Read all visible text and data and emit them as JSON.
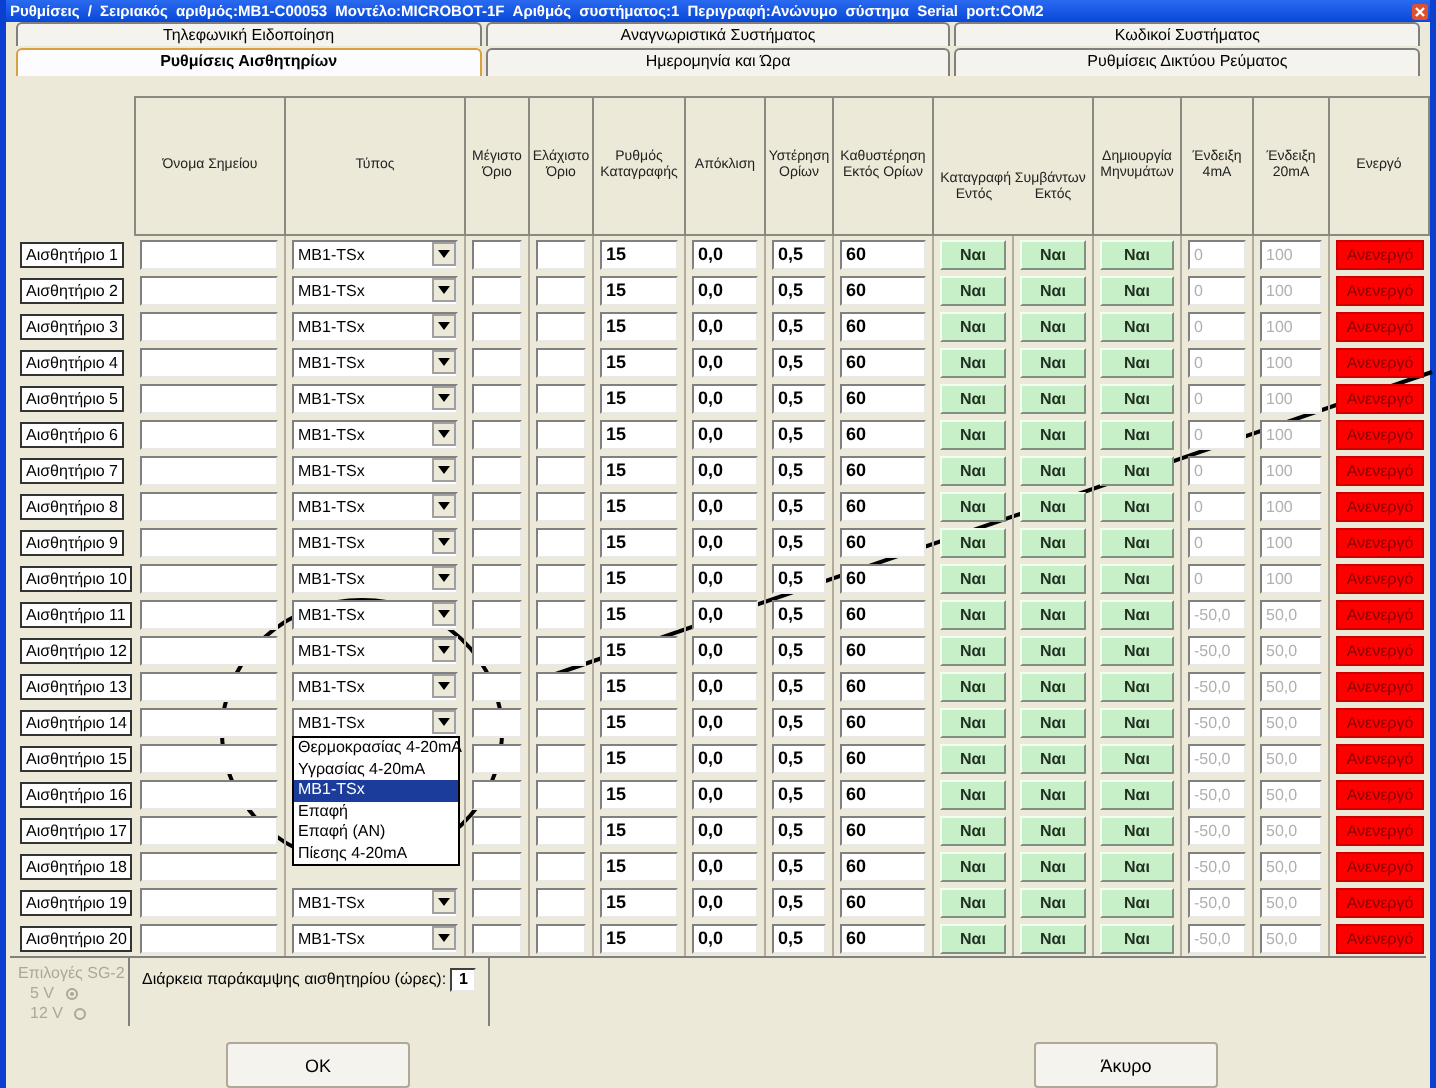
{
  "window": {
    "title": "Ρυθμίσεις / Σειριακός αριθμός:MB1-C00053 Μοντέλο:MICROBOT-1F Αριθμός συστήματος:1 Περιγραφή:Ανώνυμο σύστημα Serial port:COM2"
  },
  "tab_rows": [
    {
      "tabs": [
        {
          "label": "Τηλεφωνική Ειδοποίηση",
          "selected": false
        },
        {
          "label": "Αναγνωριστικά Συστήματος",
          "selected": false
        },
        {
          "label": "Κωδικοί Συστήματος",
          "selected": false
        }
      ]
    },
    {
      "tabs": [
        {
          "label": "Ρυθμίσεις Αισθητηρίων",
          "selected": true
        },
        {
          "label": "Ημερομηνία και Ώρα",
          "selected": false
        },
        {
          "label": "Ρυθμίσεις Δικτύου Ρεύματος",
          "selected": false
        }
      ]
    }
  ],
  "table": {
    "columns": [
      {
        "label": "Όνομα Σημείου",
        "kind": "text"
      },
      {
        "label": "Τύπος",
        "kind": "select"
      },
      {
        "label": "Μέγιστο Όριο",
        "kind": "text"
      },
      {
        "label": "Ελάχιστο Όριο",
        "kind": "text"
      },
      {
        "label": "Ρυθμός Καταγραφής",
        "kind": "number"
      },
      {
        "label": "Απόκλιση",
        "kind": "number"
      },
      {
        "label": "Υστέρηση Ορίων",
        "kind": "number"
      },
      {
        "label": "Καθυστέρηση Εκτός Ορίων",
        "kind": "number"
      },
      {
        "label": "Καταγραφή Συμβάντων",
        "children": [
          {
            "label": "Εντός",
            "kind": "toggle"
          },
          {
            "label": "Εκτός",
            "kind": "toggle"
          }
        ]
      },
      {
        "label": "Δημιουργία Μηνυμάτων",
        "kind": "toggle"
      },
      {
        "label": "Ένδειξη 4mA",
        "kind": "dimmed"
      },
      {
        "label": "Ένδειξη 20mA",
        "kind": "dimmed"
      },
      {
        "label": "Ενεργό",
        "kind": "status"
      }
    ],
    "rows": [
      {
        "sensor": "Αισθητήριο 1",
        "type": "MB1-TSx",
        "rate": "15",
        "deviation": "0,0",
        "hysteresis": "0,5",
        "delay": "60",
        "event_in": "Ναι",
        "event_out": "Ναι",
        "messages": "Ναι",
        "reading_4ma": "0",
        "reading_20ma": "100",
        "active": "Ανενεργό"
      },
      {
        "sensor": "Αισθητήριο 2",
        "type": "MB1-TSx",
        "rate": "15",
        "deviation": "0,0",
        "hysteresis": "0,5",
        "delay": "60",
        "event_in": "Ναι",
        "event_out": "Ναι",
        "messages": "Ναι",
        "reading_4ma": "0",
        "reading_20ma": "100",
        "active": "Ανενεργό"
      },
      {
        "sensor": "Αισθητήριο 3",
        "type": "MB1-TSx",
        "rate": "15",
        "deviation": "0,0",
        "hysteresis": "0,5",
        "delay": "60",
        "event_in": "Ναι",
        "event_out": "Ναι",
        "messages": "Ναι",
        "reading_4ma": "0",
        "reading_20ma": "100",
        "active": "Ανενεργό"
      },
      {
        "sensor": "Αισθητήριο 4",
        "type": "MB1-TSx",
        "rate": "15",
        "deviation": "0,0",
        "hysteresis": "0,5",
        "delay": "60",
        "event_in": "Ναι",
        "event_out": "Ναι",
        "messages": "Ναι",
        "reading_4ma": "0",
        "reading_20ma": "100",
        "active": "Ανενεργό"
      },
      {
        "sensor": "Αισθητήριο 5",
        "type": "MB1-TSx",
        "rate": "15",
        "deviation": "0,0",
        "hysteresis": "0,5",
        "delay": "60",
        "event_in": "Ναι",
        "event_out": "Ναι",
        "messages": "Ναι",
        "reading_4ma": "0",
        "reading_20ma": "100",
        "active": "Ανενεργό"
      },
      {
        "sensor": "Αισθητήριο 6",
        "type": "MB1-TSx",
        "rate": "15",
        "deviation": "0,0",
        "hysteresis": "0,5",
        "delay": "60",
        "event_in": "Ναι",
        "event_out": "Ναι",
        "messages": "Ναι",
        "reading_4ma": "0",
        "reading_20ma": "100",
        "active": "Ανενεργό"
      },
      {
        "sensor": "Αισθητήριο 7",
        "type": "MB1-TSx",
        "rate": "15",
        "deviation": "0,0",
        "hysteresis": "0,5",
        "delay": "60",
        "event_in": "Ναι",
        "event_out": "Ναι",
        "messages": "Ναι",
        "reading_4ma": "0",
        "reading_20ma": "100",
        "active": "Ανενεργό"
      },
      {
        "sensor": "Αισθητήριο 8",
        "type": "MB1-TSx",
        "rate": "15",
        "deviation": "0,0",
        "hysteresis": "0,5",
        "delay": "60",
        "event_in": "Ναι",
        "event_out": "Ναι",
        "messages": "Ναι",
        "reading_4ma": "0",
        "reading_20ma": "100",
        "active": "Ανενεργό"
      },
      {
        "sensor": "Αισθητήριο 9",
        "type": "MB1-TSx",
        "rate": "15",
        "deviation": "0,0",
        "hysteresis": "0,5",
        "delay": "60",
        "event_in": "Ναι",
        "event_out": "Ναι",
        "messages": "Ναι",
        "reading_4ma": "0",
        "reading_20ma": "100",
        "active": "Ανενεργό"
      },
      {
        "sensor": "Αισθητήριο 10",
        "type": "MB1-TSx",
        "rate": "15",
        "deviation": "0,0",
        "hysteresis": "0,5",
        "delay": "60",
        "event_in": "Ναι",
        "event_out": "Ναι",
        "messages": "Ναι",
        "reading_4ma": "0",
        "reading_20ma": "100",
        "active": "Ανενεργό"
      },
      {
        "sensor": "Αισθητήριο 11",
        "type": "MB1-TSx",
        "rate": "15",
        "deviation": "0,0",
        "hysteresis": "0,5",
        "delay": "60",
        "event_in": "Ναι",
        "event_out": "Ναι",
        "messages": "Ναι",
        "reading_4ma": "-50,0",
        "reading_20ma": "50,0",
        "active": "Ανενεργό"
      },
      {
        "sensor": "Αισθητήριο 12",
        "type": "MB1-TSx",
        "rate": "15",
        "deviation": "0,0",
        "hysteresis": "0,5",
        "delay": "60",
        "event_in": "Ναι",
        "event_out": "Ναι",
        "messages": "Ναι",
        "reading_4ma": "-50,0",
        "reading_20ma": "50,0",
        "active": "Ανενεργό"
      },
      {
        "sensor": "Αισθητήριο 13",
        "type": "MB1-TSx",
        "rate": "15",
        "deviation": "0,0",
        "hysteresis": "0,5",
        "delay": "60",
        "event_in": "Ναι",
        "event_out": "Ναι",
        "messages": "Ναι",
        "reading_4ma": "-50,0",
        "reading_20ma": "50,0",
        "active": "Ανενεργό"
      },
      {
        "sensor": "Αισθητήριο 14",
        "type": "MB1-TSx",
        "open": true,
        "options": [
          {
            "label": "Θερμοκρασίας 4-20mA",
            "selected": false
          },
          {
            "label": "Υγρασίας 4-20mA",
            "selected": false
          },
          {
            "label": "MB1-TSx",
            "selected": true
          },
          {
            "label": "Επαφή",
            "selected": false
          },
          {
            "label": "Επαφή (AN)",
            "selected": false
          },
          {
            "label": "Πίεσης 4-20mA",
            "selected": false
          }
        ],
        "rate": "15",
        "deviation": "0,0",
        "hysteresis": "0,5",
        "delay": "60",
        "event_in": "Ναι",
        "event_out": "Ναι",
        "messages": "Ναι",
        "reading_4ma": "-50,0",
        "reading_20ma": "50,0",
        "active": "Ανενεργό"
      },
      {
        "sensor": "Αισθητήριο 15",
        "rate": "15",
        "deviation": "0,0",
        "hysteresis": "0,5",
        "delay": "60",
        "event_in": "Ναι",
        "event_out": "Ναι",
        "messages": "Ναι",
        "reading_4ma": "-50,0",
        "reading_20ma": "50,0",
        "active": "Ανενεργό"
      },
      {
        "sensor": "Αισθητήριο 16",
        "rate": "15",
        "deviation": "0,0",
        "hysteresis": "0,5",
        "delay": "60",
        "event_in": "Ναι",
        "event_out": "Ναι",
        "messages": "Ναι",
        "reading_4ma": "-50,0",
        "reading_20ma": "50,0",
        "active": "Ανενεργό"
      },
      {
        "sensor": "Αισθητήριο 17",
        "rate": "15",
        "deviation": "0,0",
        "hysteresis": "0,5",
        "delay": "60",
        "event_in": "Ναι",
        "event_out": "Ναι",
        "messages": "Ναι",
        "reading_4ma": "-50,0",
        "reading_20ma": "50,0",
        "active": "Ανενεργό"
      },
      {
        "sensor": "Αισθητήριο 18",
        "rate": "15",
        "deviation": "0,0",
        "hysteresis": "0,5",
        "delay": "60",
        "event_in": "Ναι",
        "event_out": "Ναι",
        "messages": "Ναι",
        "reading_4ma": "-50,0",
        "reading_20ma": "50,0",
        "active": "Ανενεργό"
      },
      {
        "sensor": "Αισθητήριο 19",
        "type": "MB1-TSx",
        "rate": "15",
        "deviation": "0,0",
        "hysteresis": "0,5",
        "delay": "60",
        "event_in": "Ναι",
        "event_out": "Ναι",
        "messages": "Ναι",
        "reading_4ma": "-50,0",
        "reading_20ma": "50,0",
        "active": "Ανενεργό"
      },
      {
        "sensor": "Αισθητήριο 20",
        "type": "MB1-TSx",
        "rate": "15",
        "deviation": "0,0",
        "hysteresis": "0,5",
        "delay": "60",
        "event_in": "Ναι",
        "event_out": "Ναι",
        "messages": "Ναι",
        "reading_4ma": "-50,0",
        "reading_20ma": "50,0",
        "active": "Ανενεργό"
      }
    ]
  },
  "sg2": {
    "title": "Επιλογές SG-2",
    "disabled": true,
    "options": [
      {
        "label": "5 V",
        "selected": true
      },
      {
        "label": "12 V",
        "selected": false
      }
    ]
  },
  "bypass": {
    "label": "Διάρκεια παράκαμψης αισθητηρίου (ώρες):",
    "value": "1"
  },
  "buttons": [
    {
      "label": "OK"
    },
    {
      "label": "Άκυρο"
    }
  ]
}
